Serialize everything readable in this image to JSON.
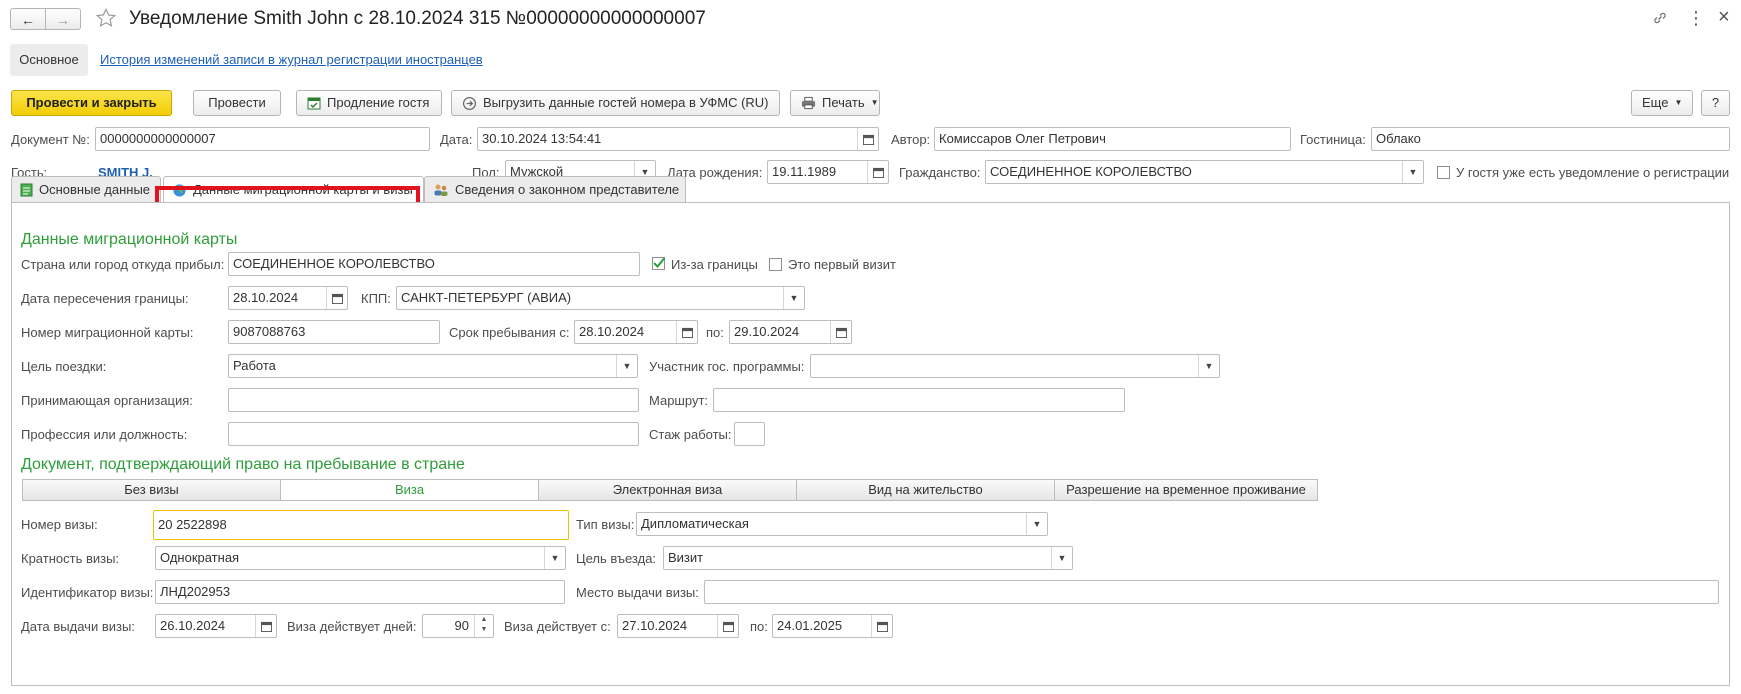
{
  "window": {
    "title": "Уведомление Smith John с 28.10.2024 315 №00000000000000007",
    "nav_back": "←",
    "nav_forward": "→",
    "more": "⋮",
    "close": "×"
  },
  "top_tabs": {
    "main": "Основное",
    "history_link": "История изменений записи в журнал регистрации иностранцев"
  },
  "toolbar": {
    "post_close": "Провести и закрыть",
    "post": "Провести",
    "extend": "Продление гостя",
    "export": "Выгрузить данные гостей номера в УФМС (RU)",
    "print": "Печать",
    "more": "Еще",
    "help": "?"
  },
  "header": {
    "doc_label": "Документ №:",
    "doc_value": "0000000000000007",
    "date_label": "Дата:",
    "date_value": "30.10.2024 13:54:41",
    "author_label": "Автор:",
    "author_value": "Комиссаров Олег Петрович",
    "hotel_label": "Гостиница:",
    "hotel_value": "Облако",
    "guest_label": "Гость:",
    "guest_value": "SMITH J.",
    "sex_label": "Пол:",
    "sex_value": "Мужской",
    "birth_label": "Дата рождения:",
    "birth_value": "19.11.1989",
    "citizenship_label": "Гражданство:",
    "citizenship_value": "СОЕДИНЕННОЕ КОРОЛЕВСТВО",
    "has_notice_label": "У гостя уже есть уведомление о регистрации"
  },
  "tabs": {
    "basic": "Основные данные",
    "migration": "Данные миграционной карты и визы",
    "representative": "Сведения о законном представителе"
  },
  "migration": {
    "section_title": "Данные миграционной карты",
    "from_label": "Страна или город откуда прибыл:",
    "from_value": "СОЕДИНЕННОЕ КОРОЛЕВСТВО",
    "abroad_label": "Из-за границы",
    "first_visit_label": "Это первый визит",
    "cross_date_label": "Дата пересечения границы:",
    "cross_date_value": "28.10.2024",
    "kpp_label": "КПП:",
    "kpp_value": "САНКТ-ПЕТЕРБУРГ (АВИА)",
    "card_label": "Номер миграционной карты:",
    "card_value": "9087088763",
    "stay_from_label": "Срок пребывания с:",
    "stay_from_value": "28.10.2024",
    "stay_to_label": "по:",
    "stay_to_value": "29.10.2024",
    "purpose_label": "Цель поездки:",
    "purpose_value": "Работа",
    "program_label": "Участник гос. программы:",
    "program_value": "",
    "org_label": "Принимающая организация:",
    "org_value": "",
    "route_label": "Маршрут:",
    "route_value": "",
    "profession_label": "Профессия или должность:",
    "profession_value": "",
    "experience_label": "Стаж работы:",
    "experience_value": ""
  },
  "visa": {
    "section_title": "Документ, подтверждающий право на пребывание в стране",
    "segments": [
      "Без визы",
      "Виза",
      "Электронная виза",
      "Вид на жительство",
      "Разрешение на временное проживание"
    ],
    "number_label": "Номер визы:",
    "number_value": "20 2522898",
    "type_label": "Тип визы:",
    "type_value": "Дипломатическая",
    "multiplicity_label": "Кратность визы:",
    "multiplicity_value": "Однократная",
    "entry_purpose_label": "Цель въезда:",
    "entry_purpose_value": "Визит",
    "id_label": "Идентификатор визы:",
    "id_value": "ЛНД202953",
    "issue_place_label": "Место выдачи визы:",
    "issue_place_value": "",
    "issue_date_label": "Дата выдачи визы:",
    "issue_date_value": "26.10.2024",
    "days_label": "Виза действует дней:",
    "days_value": "90",
    "valid_from_label": "Виза действует с:",
    "valid_from_value": "27.10.2024",
    "valid_to_label": "по:",
    "valid_to_value": "24.01.2025"
  },
  "colors": {
    "primary_button": "#f2cd06",
    "section_title": "#2e9e3a",
    "highlight_box": "#e0141e",
    "link": "#1f5fb3",
    "focus_border": "#f0c000"
  }
}
